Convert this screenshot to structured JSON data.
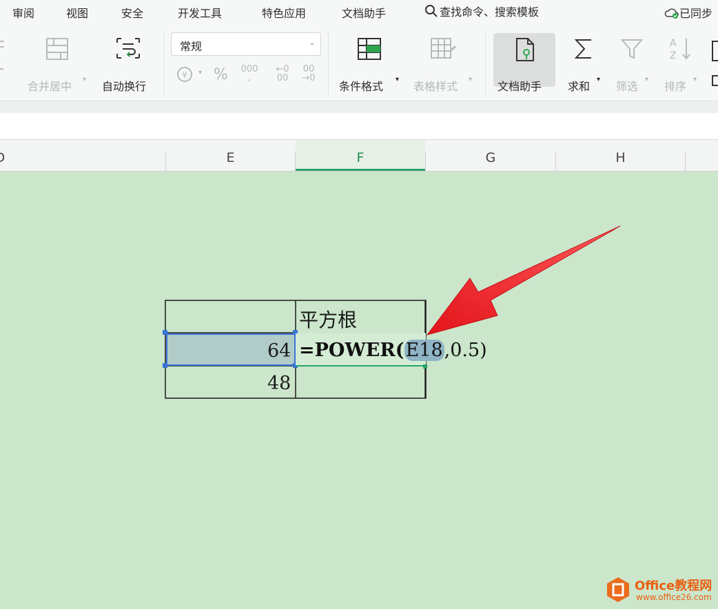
{
  "menubar": {
    "items": [
      "审阅",
      "视图",
      "安全",
      "开发工具",
      "特色应用",
      "文档助手"
    ],
    "search": "查找命令、搜索模板",
    "sync": "已同步"
  },
  "ribbon": {
    "merge_center": "合并居中",
    "auto_wrap": "自动换行",
    "number_format": "常规",
    "percent": "%",
    "thousands": "000",
    "inc_decimal": "←0\n00",
    "dec_decimal": "00\n→0",
    "conditional_format": "条件格式",
    "table_style": "表格样式",
    "doc_assistant": "文档助手",
    "sum": "求和",
    "filter": "筛选",
    "sort": "排序"
  },
  "columns": [
    "D",
    "E",
    "F",
    "G",
    "H"
  ],
  "table": {
    "header_f": "平方根",
    "e_row1": "64",
    "f_row1_prefix": "=POWER(",
    "f_row1_ref": "E18",
    "f_row1_suffix": ",0.5)",
    "e_row2": "48"
  },
  "watermark": {
    "brand": "Office教程网",
    "url": "www.office26.com"
  },
  "colors": {
    "sheet_bg": "#cbe6cb",
    "selection_blue": "#3a74d8",
    "active_column_green": "#29a36a",
    "arrow_red": "#e3141b",
    "brand_orange": "#ec6b1c"
  }
}
